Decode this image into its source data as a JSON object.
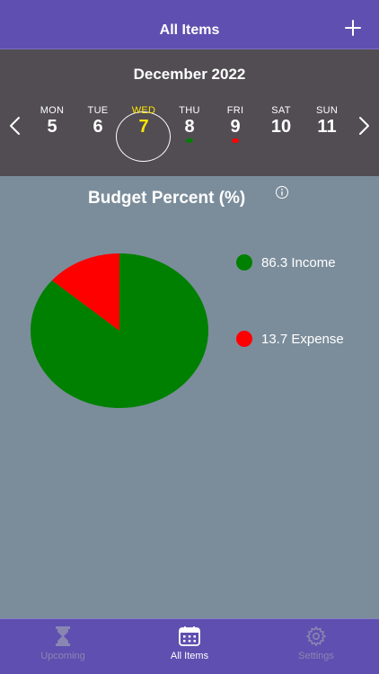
{
  "header": {
    "title": "All Items"
  },
  "calendar": {
    "month": "December 2022",
    "days": [
      {
        "name": "MON",
        "num": "5"
      },
      {
        "name": "TUE",
        "num": "6"
      },
      {
        "name": "WED",
        "num": "7",
        "selected": true
      },
      {
        "name": "THU",
        "num": "8",
        "marker": "income"
      },
      {
        "name": "FRI",
        "num": "9",
        "marker": "expense"
      },
      {
        "name": "SAT",
        "num": "10"
      },
      {
        "name": "SUN",
        "num": "11"
      }
    ]
  },
  "chart": {
    "title": "Budget Percent (%)",
    "legend": [
      {
        "label": "86.3 Income"
      },
      {
        "label": "13.7 Expense"
      }
    ]
  },
  "chart_data": {
    "type": "pie",
    "title": "Budget Percent (%)",
    "labels": [
      "Income",
      "Expense"
    ],
    "values": [
      86.3,
      13.7
    ],
    "colors": [
      "#008000",
      "#ff0000"
    ],
    "legend_position": "right"
  },
  "colors": {
    "nav": "#5f4fb0",
    "calendar_bg": "#514d52",
    "content_bg": "#7b8d9b",
    "selected_day": "#ffe600",
    "income": "#008000",
    "expense": "#ff0000"
  },
  "tabs": [
    {
      "label": "Upcoming",
      "icon": "hourglass-icon",
      "active": false
    },
    {
      "label": "All Items",
      "icon": "calendar-icon",
      "active": true
    },
    {
      "label": "Settings",
      "icon": "gear-icon",
      "active": false
    }
  ]
}
